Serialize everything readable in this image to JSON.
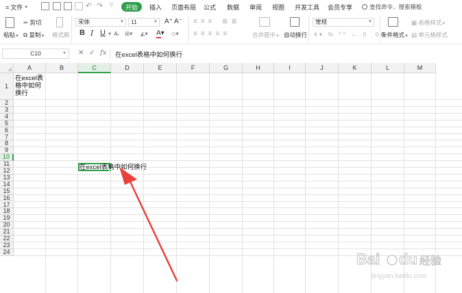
{
  "menubar": {
    "file_label": "文件",
    "tabs": [
      "开始",
      "插入",
      "页面布局",
      "公式",
      "数据",
      "审阅",
      "视图",
      "开发工具",
      "会员专享"
    ],
    "search_label": "查找命令、搜索模板"
  },
  "ribbon": {
    "paste_label": "粘贴",
    "cut_label": "剪切",
    "copy_label": "复制",
    "format_painter_label": "格式刷",
    "font_name": "宋体",
    "font_size": "11",
    "bold": "B",
    "italic": "I",
    "underline": "U",
    "merge_label": "合并居中",
    "wrap_label": "自动换行",
    "number_format": "常规",
    "cond_format_label": "条件格式",
    "table_style_label": "表格样式",
    "cell_style_label": "单元格样式"
  },
  "formula_bar": {
    "cell_ref": "C10",
    "content": "在excel表格中如何换行"
  },
  "sheet": {
    "columns": [
      "A",
      "B",
      "C",
      "D",
      "E",
      "F",
      "G",
      "H",
      "I",
      "J",
      "K",
      "L",
      "M"
    ],
    "rows": [
      "1",
      "2",
      "3",
      "4",
      "5",
      "6",
      "7",
      "8",
      "9",
      "10",
      "11",
      "12",
      "13",
      "14",
      "15",
      "16",
      "17",
      "18",
      "19",
      "20",
      "21",
      "22",
      "23",
      "24"
    ],
    "selected_column": "C",
    "selected_row": "10",
    "cell_A1_lines": [
      "在excel表",
      "格中如何",
      "换行"
    ],
    "cell_C10_text": "在excel表格中如何换行"
  },
  "colors": {
    "accent": "#2e9e4a",
    "arrow": "#e8413c"
  }
}
